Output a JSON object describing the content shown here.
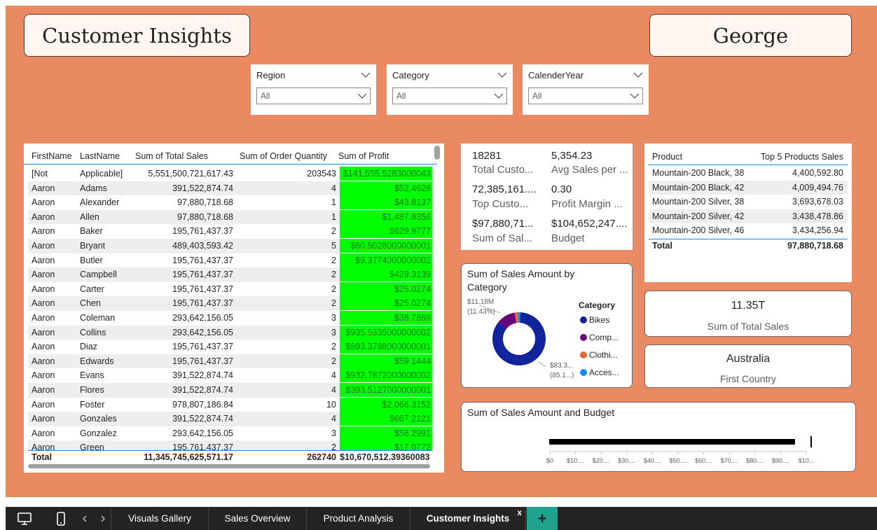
{
  "header": {
    "title": "Customer Insights",
    "user": "George"
  },
  "slicers": [
    {
      "label": "Region",
      "value": "All"
    },
    {
      "label": "Category",
      "value": "All"
    },
    {
      "label": "CalenderYear",
      "value": "All"
    }
  ],
  "table": {
    "columns": [
      "FirstName",
      "LastName",
      "Sum of Total Sales",
      "Sum of Order Quantity",
      "Sum of Profit"
    ],
    "rows": [
      [
        "[Not",
        "Applicable]",
        "5,551,500,721,617.43",
        "203543",
        "$141,555.5283000043"
      ],
      [
        "Aaron",
        "Adams",
        "391,522,874.74",
        "4",
        "$52.4628"
      ],
      [
        "Aaron",
        "Alexander",
        "97,880,718.68",
        "1",
        "$43.8137"
      ],
      [
        "Aaron",
        "Allen",
        "97,880,718.68",
        "1",
        "$1,487.8356"
      ],
      [
        "Aaron",
        "Baker",
        "195,761,437.37",
        "2",
        "$629.9777"
      ],
      [
        "Aaron",
        "Bryant",
        "489,403,593.42",
        "5",
        "$60.5028000000001"
      ],
      [
        "Aaron",
        "Butler",
        "195,761,437.37",
        "2",
        "$9.3774000000002"
      ],
      [
        "Aaron",
        "Campbell",
        "195,761,437.37",
        "2",
        "$429.3139"
      ],
      [
        "Aaron",
        "Carter",
        "195,761,437.37",
        "2",
        "$25.0274"
      ],
      [
        "Aaron",
        "Chen",
        "195,761,437.37",
        "2",
        "$25.0274"
      ],
      [
        "Aaron",
        "Coleman",
        "293,642,156.05",
        "3",
        "$38.7869"
      ],
      [
        "Aaron",
        "Collins",
        "293,642,156.05",
        "3",
        "$935.5335000000002"
      ],
      [
        "Aaron",
        "Diaz",
        "195,761,437.37",
        "2",
        "$893.3788000000001"
      ],
      [
        "Aaron",
        "Edwards",
        "195,761,437.37",
        "2",
        "$59.1444"
      ],
      [
        "Aaron",
        "Evans",
        "391,522,874.74",
        "4",
        "$932.7872000000002"
      ],
      [
        "Aaron",
        "Flores",
        "391,522,874.74",
        "4",
        "$393.5127000000001"
      ],
      [
        "Aaron",
        "Foster",
        "978,807,186.84",
        "10",
        "$2,066.3152"
      ],
      [
        "Aaron",
        "Gonzales",
        "391,522,874.74",
        "4",
        "$667.2121"
      ],
      [
        "Aaron",
        "Gonzalez",
        "293,642,156.05",
        "3",
        "$58.2991"
      ],
      [
        "Aaron",
        "Green",
        "195,761,437.37",
        "2",
        "$17.0772"
      ]
    ],
    "total": {
      "label": "Total",
      "sales": "11,345,745,625,571.17",
      "qty": "262740",
      "profit": "$10,670,512.39360083"
    }
  },
  "kpis": [
    {
      "value": "18281",
      "label": "Total Custo..."
    },
    {
      "value": "5,354.23",
      "label": "Avg Sales per ..."
    },
    {
      "value": "72,385,161....",
      "label": "Top Custo..."
    },
    {
      "value": "0.30",
      "label": "Profit Margin ..."
    },
    {
      "value": "$97,880,71...",
      "label": "Sum of Sal..."
    },
    {
      "value": "$104,652,247....",
      "label": "Budget"
    }
  ],
  "top_products": {
    "columns": [
      "Product",
      "Top 5 Products Sales"
    ],
    "rows": [
      [
        "Mountain-200 Black, 38",
        "4,400,592.80"
      ],
      [
        "Mountain-200 Black, 42",
        "4,009,494.76"
      ],
      [
        "Mountain-200 Silver, 38",
        "3,693,678.03"
      ],
      [
        "Mountain-200 Silver, 42",
        "3,438,478.86"
      ],
      [
        "Mountain-200 Silver, 46",
        "3,434,256.94"
      ]
    ],
    "total_label": "Total",
    "total_value": "97,880,718.68"
  },
  "donut": {
    "title_line1": "Sum of Sales Amount by",
    "title_line2": "Category",
    "label_small_1": "$11.18M",
    "label_small_2": "(11.43%)",
    "label_big_1": "$83.3...",
    "label_big_2": "(85.1...)",
    "legend_title": "Category",
    "legend": [
      "Bikes",
      "Comp...",
      "Clothi...",
      "Acces..."
    ]
  },
  "cards": [
    {
      "value": "11.35T",
      "label": "Sum of Total Sales"
    },
    {
      "value": "Australia",
      "label": "First Country"
    }
  ],
  "bullet": {
    "title": "Sum of Sales Amount and Budget",
    "ticks": [
      "$0",
      "$10....",
      "$20....",
      "$30....",
      "$40....",
      "$50....",
      "$60....",
      "$70....",
      "$80....",
      "$90....",
      "$10..."
    ]
  },
  "tabs": {
    "items": [
      "Visuals Gallery",
      "Sales Overview",
      "Product Analysis",
      "Customer Insights"
    ],
    "close": "x",
    "add": "+"
  },
  "colors": {
    "background": "#EA8A62",
    "profit_fill": "#00FF00",
    "bikes": "#12239E",
    "components": "#6B007B",
    "clothing": "#E66C37",
    "accessories": "#118DFF"
  },
  "chart_data": {
    "type": "pie",
    "categories": [
      "Bikes",
      "Comp...",
      "Clothi...",
      "Acces..."
    ],
    "values": [
      85.1,
      11.43,
      1.8,
      1.67
    ]
  }
}
